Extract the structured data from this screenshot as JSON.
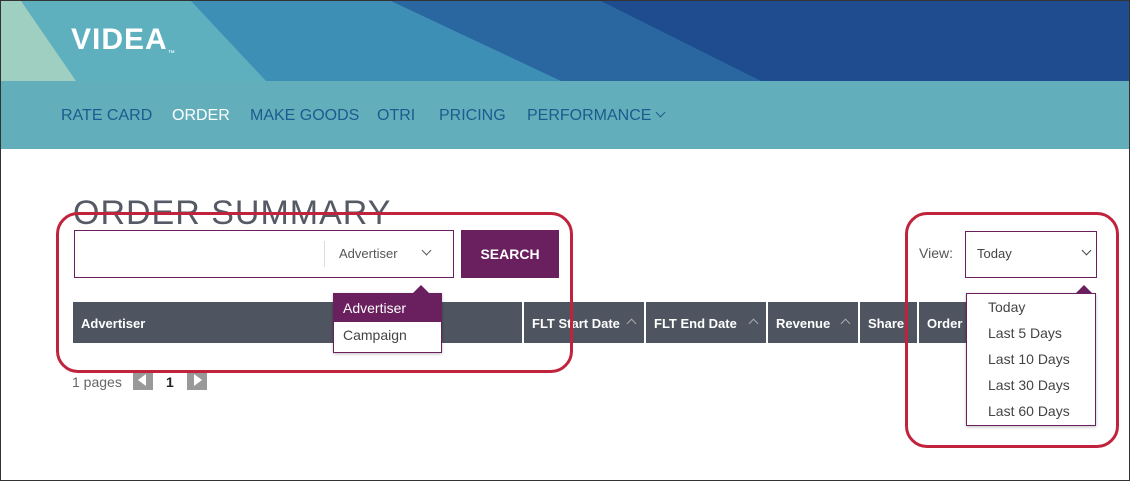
{
  "brand": {
    "logo_text": "VIDEA",
    "logo_tm": "™"
  },
  "nav": [
    {
      "label": "RATE CARD",
      "active": false
    },
    {
      "label": "ORDER",
      "active": true
    },
    {
      "label": "MAKE GOODS",
      "active": false
    },
    {
      "label": "OTRI",
      "active": false
    },
    {
      "label": "PRICING",
      "active": false
    },
    {
      "label": "PERFORMANCE",
      "active": false,
      "has_dropdown": true
    }
  ],
  "page": {
    "title": "ORDER SUMMARY"
  },
  "search": {
    "input_value": "",
    "filter_selected": "Advertiser",
    "filter_options": [
      "Advertiser",
      "Campaign"
    ],
    "button_label": "SEARCH"
  },
  "view": {
    "label": "View:",
    "selected": "Today",
    "options": [
      "Today",
      "Last 5 Days",
      "Last 10 Days",
      "Last 30 Days",
      "Last 60 Days"
    ]
  },
  "table": {
    "columns": [
      "Advertiser",
      "FLT Start Date",
      "FLT End Date",
      "Revenue",
      "Share",
      "Order #"
    ]
  },
  "pagination": {
    "summary": "1 pages",
    "current": "1"
  },
  "colors": {
    "accent": "#6a1f5e",
    "nav_bg": "#62afbb",
    "header_dark": "#4e5560",
    "callout": "#c0243c"
  }
}
